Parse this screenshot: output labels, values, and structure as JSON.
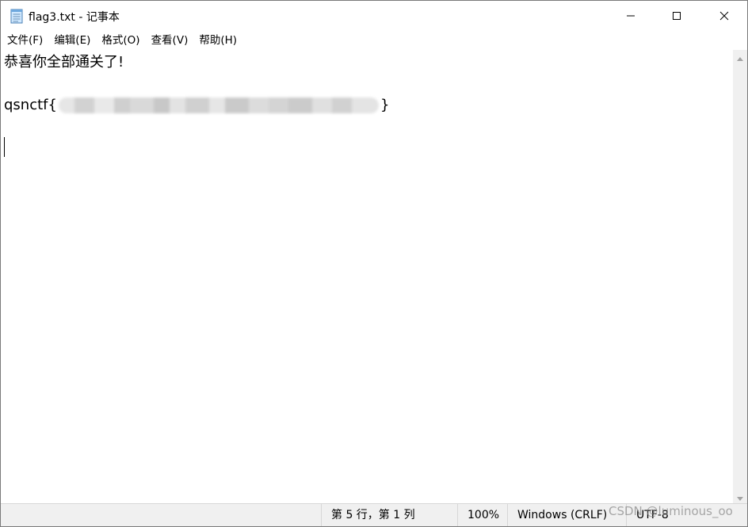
{
  "window": {
    "title": "flag3.txt - 记事本",
    "icon": "notepad-icon",
    "controls": {
      "minimize": "minimize-icon",
      "maximize": "maximize-icon",
      "close": "close-icon"
    }
  },
  "menu": {
    "items": [
      {
        "label": "文件(F)"
      },
      {
        "label": "编辑(E)"
      },
      {
        "label": "格式(O)"
      },
      {
        "label": "查看(V)"
      },
      {
        "label": "帮助(H)"
      }
    ]
  },
  "editor": {
    "lines": [
      "恭喜你全部通关了!",
      "",
      "qsnctf{",
      "}"
    ],
    "redacted": true
  },
  "statusbar": {
    "position": "第 5 行，第 1 列",
    "zoom": "100%",
    "line_ending": "Windows (CRLF)",
    "encoding": "UTF-8"
  },
  "watermark": {
    "text": "CSDN @luminous_oo"
  }
}
